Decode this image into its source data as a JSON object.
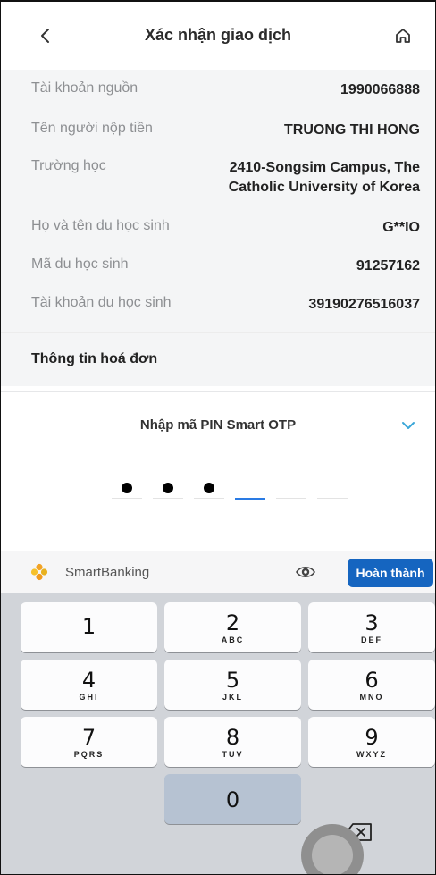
{
  "header": {
    "title": "Xác nhận giao dịch",
    "back_icon": "chevron-left-icon",
    "home_icon": "home-icon"
  },
  "details": [
    {
      "label": "Tài khoản nguồn",
      "value": "1990066888"
    },
    {
      "label": "Tên người nộp tiền",
      "value": "TRUONG THI HONG"
    },
    {
      "label": "Trường học",
      "value": "2410-Songsim Campus, The Catholic University of Korea"
    },
    {
      "label": "Họ và tên du học sinh",
      "value": "G**IO"
    },
    {
      "label": "Mã du học sinh",
      "value": "91257162"
    },
    {
      "label": "Tài khoản du học sinh",
      "value": "39190276516037"
    }
  ],
  "invoice_section": {
    "title": "Thông tin hoá đơn"
  },
  "pin": {
    "title": "Nhập mã PIN Smart OTP",
    "digits_entered": 3,
    "total_digits": 6
  },
  "keyboard_header": {
    "brand": "SmartBanking",
    "done_label": "Hoàn thành"
  },
  "keys": [
    {
      "num": "1",
      "letters": ""
    },
    {
      "num": "2",
      "letters": "ABC"
    },
    {
      "num": "3",
      "letters": "DEF"
    },
    {
      "num": "4",
      "letters": "GHI"
    },
    {
      "num": "5",
      "letters": "JKL"
    },
    {
      "num": "6",
      "letters": "MNO"
    },
    {
      "num": "7",
      "letters": "PQRS"
    },
    {
      "num": "8",
      "letters": "TUV"
    },
    {
      "num": "9",
      "letters": "WXYZ"
    },
    {
      "num": "0",
      "letters": ""
    }
  ],
  "colors": {
    "accent": "#1565c0",
    "pin_active": "#2a7be4",
    "chevron": "#3aa6d8",
    "details_bg": "#f4f5f6",
    "keyboard_bg": "#d1d4d9"
  }
}
